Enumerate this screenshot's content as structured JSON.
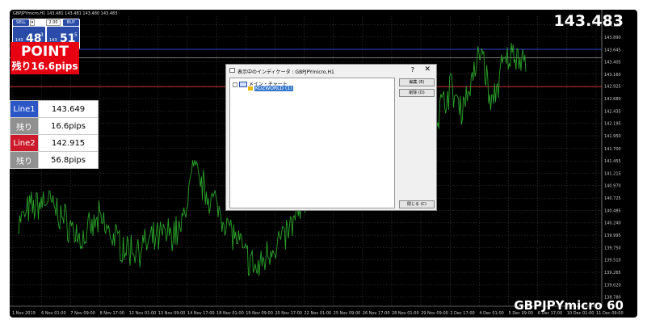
{
  "window": {
    "title_bar": "GBPJPYmicro,H1  143.481 143.481 143.480 143.483"
  },
  "trade_panel": {
    "sell_label": "SELL",
    "buy_label": "BUY",
    "lot": "2.00",
    "sell_prefix": "143",
    "sell_big": "48",
    "sell_sup": "3",
    "buy_prefix": "143",
    "buy_big": "51",
    "buy_sup": "5"
  },
  "point_box": {
    "title": "POINT",
    "remaining": "残り16.6pips"
  },
  "info_table": {
    "rows": [
      {
        "label": "Line1",
        "value": "143.649",
        "color": "#2a56c6"
      },
      {
        "label": "残り",
        "value": "16.6pips",
        "color": "#909090"
      },
      {
        "label": "Line2",
        "value": "142.915",
        "color": "#cc1a2a"
      },
      {
        "label": "残り",
        "value": "56.8pips",
        "color": "#909090"
      }
    ]
  },
  "current_price": "143.483",
  "symbol_label": "GBPJPYmicro 60",
  "dialog": {
    "title": "表示中のインディケータ : GBPJPYmicro,H1",
    "help": "?",
    "close": "✕",
    "tree_root": "メイン・チャート",
    "tree_child": "KOZWORLD (1)",
    "edit_button": "編集 (E)",
    "delete_button": "削除 (D)",
    "close_button": "閉じる (C)"
  },
  "chart_data": {
    "type": "line",
    "symbol": "GBPJPYmicro",
    "timeframe": "H1",
    "y_ticks": [
      "144.135",
      "143.890",
      "143.645",
      "143.405",
      "143.160",
      "142.925",
      "142.680",
      "142.435",
      "142.195",
      "141.950",
      "141.700",
      "141.455",
      "141.215",
      "140.970",
      "140.725",
      "140.485",
      "140.240",
      "139.995",
      "139.750",
      "139.510",
      "139.265",
      "139.020",
      "138.780"
    ],
    "x_ticks": [
      "1 Nov 2019",
      "6 Nov 01:00",
      "7 Nov 09:00",
      "8 Nov 17:00",
      "12 Nov 01:00",
      "13 Nov 09:00",
      "14 Nov 17:00",
      "18 Nov 01:00",
      "19 Nov 09:00",
      "20 Nov 17:00",
      "22 Nov 01:00",
      "25 Nov 09:00",
      "26 Nov 17:00",
      "28 Nov 01:00",
      "29 Nov 09:00",
      "2 Dec 17:00",
      "4 Dec 01:00",
      "5 Dec 09:00",
      "6 Dec 17:00",
      "10 Dec 01:00",
      "11 Dec 09:00"
    ],
    "ylim": [
      138.6,
      144.3
    ],
    "h_lines": [
      {
        "name": "Line1",
        "value": 143.649,
        "color": "#3355ff"
      },
      {
        "name": "Line2",
        "value": 142.915,
        "color": "#ff3333"
      },
      {
        "name": "Bid",
        "value": 143.483,
        "color": "#888888"
      }
    ],
    "series_color": "#2aa02a",
    "anchors": [
      [
        0,
        140.2
      ],
      [
        0.02,
        140.5
      ],
      [
        0.05,
        140.7
      ],
      [
        0.08,
        140.3
      ],
      [
        0.11,
        139.9
      ],
      [
        0.14,
        140.3
      ],
      [
        0.16,
        140.0
      ],
      [
        0.19,
        139.7
      ],
      [
        0.22,
        139.8
      ],
      [
        0.25,
        140.0
      ],
      [
        0.28,
        140.1
      ],
      [
        0.3,
        141.3
      ],
      [
        0.32,
        140.9
      ],
      [
        0.345,
        140.5
      ],
      [
        0.37,
        140.0
      ],
      [
        0.39,
        139.6
      ],
      [
        0.41,
        139.3
      ],
      [
        0.43,
        139.7
      ],
      [
        0.46,
        140.0
      ],
      [
        0.485,
        140.5
      ],
      [
        0.51,
        141.1
      ],
      [
        0.535,
        141.3
      ],
      [
        0.56,
        141.6
      ],
      [
        0.58,
        141.7
      ],
      [
        0.6,
        141.9
      ],
      [
        0.62,
        141.3
      ],
      [
        0.64,
        141.8
      ],
      [
        0.66,
        141.5
      ],
      [
        0.68,
        142.0
      ],
      [
        0.7,
        141.7
      ],
      [
        0.72,
        142.4
      ],
      [
        0.74,
        142.9
      ],
      [
        0.76,
        142.5
      ],
      [
        0.78,
        143.1
      ],
      [
        0.795,
        143.7
      ],
      [
        0.81,
        142.5
      ],
      [
        0.83,
        143.3
      ],
      [
        0.85,
        143.6
      ],
      [
        0.87,
        143.45
      ]
    ]
  }
}
